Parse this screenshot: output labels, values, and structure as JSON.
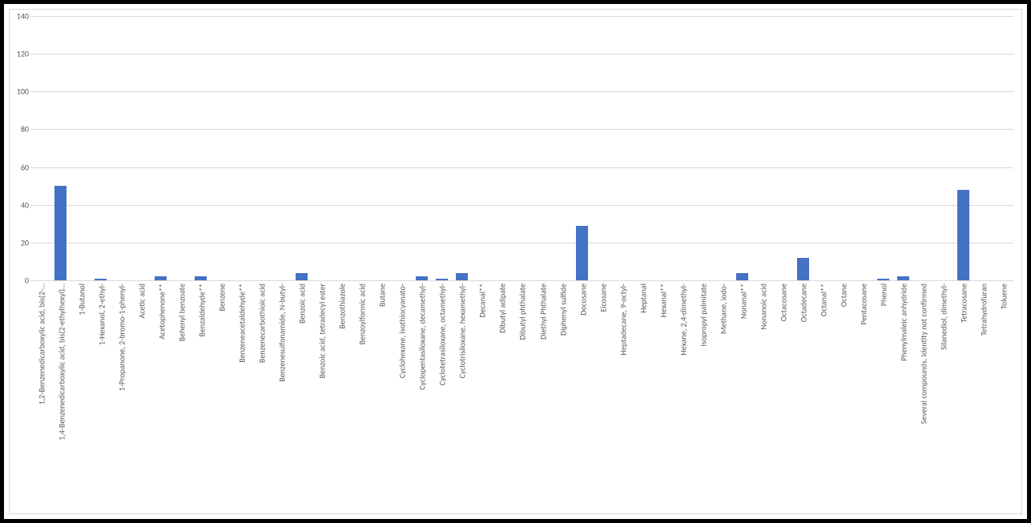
{
  "chart_data": {
    "type": "bar",
    "title": "",
    "xlabel": "",
    "ylabel": "",
    "ylim": [
      0,
      140
    ],
    "yticks": [
      0,
      20,
      40,
      60,
      80,
      100,
      120,
      140
    ],
    "categories": [
      "1,2-Benzenedicarboxylic acid, bis(2-…",
      "1,4-Benzenedicarboxylic acid, bis(2-ethylhexyl)…",
      "1-Butanol",
      "1-Hexanol, 2-ethyl-",
      "1-Propanone, 2-bromo-1-phenyl-",
      "Acetic acid",
      "Acetophenone**",
      "Behenyl benzoate",
      "Benzaldehyde**",
      "Benzene",
      "Benzeneacetaldehyde**",
      "Benzenecarbothioic acid",
      "Benzenesulfonamide, N-butyl-",
      "Benzoic acid",
      "Benzoic acid, tetradecyl ester",
      "Benzothiazole",
      "Benzoylformic acid",
      "Butane",
      "Cyclohexane, isothiocyanato-",
      "Cyclopentasiloxane, decamethyl-",
      "Cyclotetrasiloxane, octamethyl-",
      "Cyclotrisiloxane, hexamethyl-",
      "Decanal**",
      "Dibutyl adipate",
      "Dibutyl phthalate",
      "Diethyl Phthalate",
      "Diphenyl sulfide",
      "Docosane",
      "Eicosane",
      "Heptadecane, 9-octyl-",
      "Heptanal",
      "Hexanal**",
      "Hexane, 2,4-dimethyl-",
      "Isopropyl palmitate",
      "Methane, iodo-",
      "Nonanal**",
      "Nonanoic acid",
      "Octacosane",
      "Octadecane",
      "Octanal**",
      "Octane",
      "Pentacosane",
      "Phenol",
      "Phenylmaleic anhydride",
      "Several compounds. Identity not confirmed",
      "Silanediol, dimethyl-",
      "Tetracosane",
      "Tetrahydrofuran",
      "Toluene"
    ],
    "values": [
      0,
      50,
      0,
      1,
      0,
      0,
      2,
      0,
      2,
      0,
      0,
      0,
      0,
      4,
      0,
      0,
      0,
      0,
      0,
      2,
      1,
      4,
      0,
      0,
      0,
      0,
      0,
      29,
      0,
      0,
      0,
      0,
      0,
      0,
      0,
      4,
      0,
      0,
      12,
      0,
      0,
      0,
      1,
      2,
      0,
      0,
      48,
      0,
      0
    ]
  }
}
